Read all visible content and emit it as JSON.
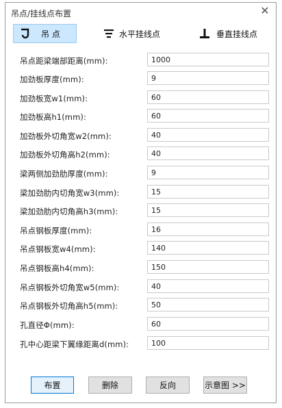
{
  "window": {
    "title": "吊点/挂线点布置"
  },
  "tabs": [
    {
      "label": "吊 点",
      "icon": "hook-icon"
    },
    {
      "label": "水平挂线点",
      "icon": "horizontal-line-point-icon"
    },
    {
      "label": "垂直挂线点",
      "icon": "vertical-line-point-icon"
    }
  ],
  "fields": [
    {
      "label": "吊点距梁端部距离(mm):",
      "value": "1000"
    },
    {
      "label": "加劲板厚度(mm):",
      "value": "9"
    },
    {
      "label": "加劲板宽w1(mm):",
      "value": "60"
    },
    {
      "label": "加劲板高h1(mm):",
      "value": "60"
    },
    {
      "label": "加劲板外切角宽w2(mm):",
      "value": "40"
    },
    {
      "label": "加劲板外切角高h2(mm):",
      "value": "40"
    },
    {
      "label": "梁两侧加劲肋厚度(mm):",
      "value": "9"
    },
    {
      "label": "梁加劲肋内切角宽w3(mm):",
      "value": "15"
    },
    {
      "label": "梁加劲肋内切角高h3(mm):",
      "value": "15"
    },
    {
      "label": "吊点钢板厚度(mm):",
      "value": "16"
    },
    {
      "label": "吊点钢板宽w4(mm):",
      "value": "140"
    },
    {
      "label": "吊点钢板高h4(mm):",
      "value": "150"
    },
    {
      "label": "吊点钢板外切角宽w5(mm):",
      "value": "40"
    },
    {
      "label": "吊点钢板外切角高h5(mm):",
      "value": "50"
    },
    {
      "label": "孔直径Φ(mm):",
      "value": "60"
    },
    {
      "label": "孔中心距梁下翼缘距离d(mm):",
      "value": "100"
    }
  ],
  "buttons": {
    "place": "布置",
    "delete": "删除",
    "reverse": "反向",
    "diagram": "示意图 >>"
  }
}
